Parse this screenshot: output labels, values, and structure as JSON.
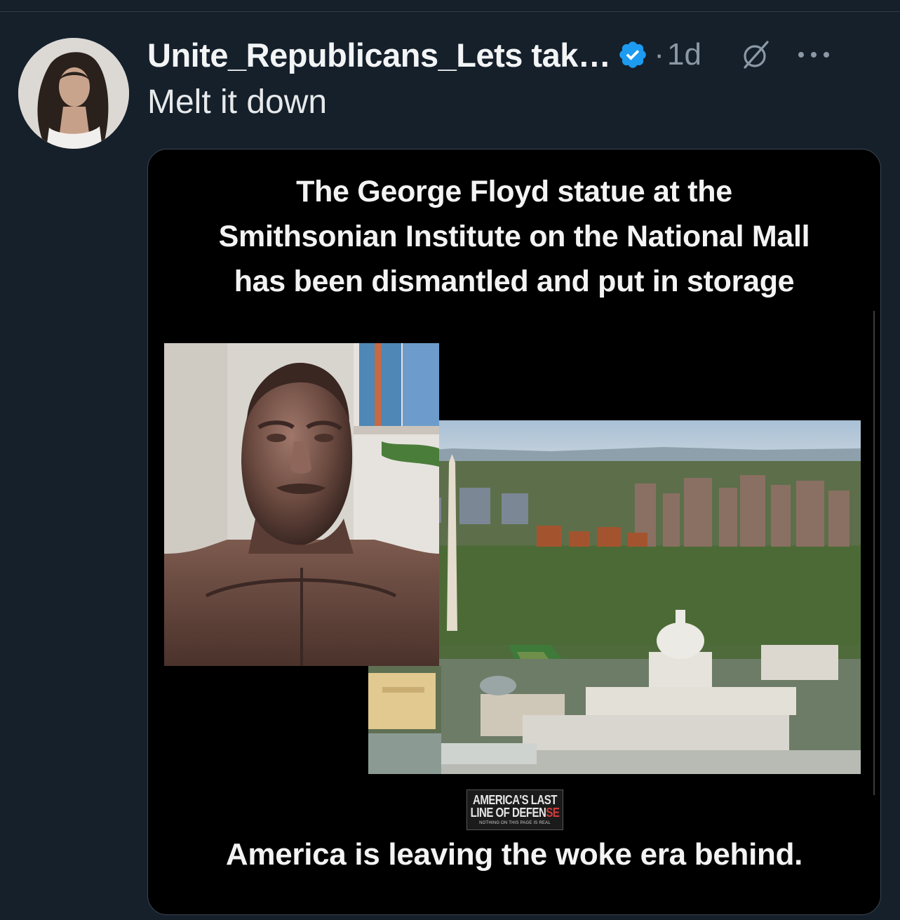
{
  "tweet": {
    "display_name": "Unite_Republicans_Lets tak…",
    "separator": "·",
    "timestamp": "1d",
    "text": "Melt it down",
    "icons": {
      "avatar": "profile-photo",
      "verified": "verified-badge-icon",
      "grok": "grok-icon",
      "more": "more-options-icon"
    },
    "colors": {
      "background": "#15202b",
      "verified": "#1d9bf0",
      "muted": "#8b98a5"
    }
  },
  "media": {
    "headline_lines": [
      "The George Floyd statue at the",
      "Smithsonian Institute on the National Mall",
      "has been dismantled and put in storage"
    ],
    "logo": {
      "line1": "AMERICA'S LAST",
      "line2_a": "LINE OF DEFEN",
      "line2_b": "SE",
      "line3": "NOTHING ON THIS PAGE IS REAL"
    },
    "tagline": "America is leaving the woke era behind."
  }
}
